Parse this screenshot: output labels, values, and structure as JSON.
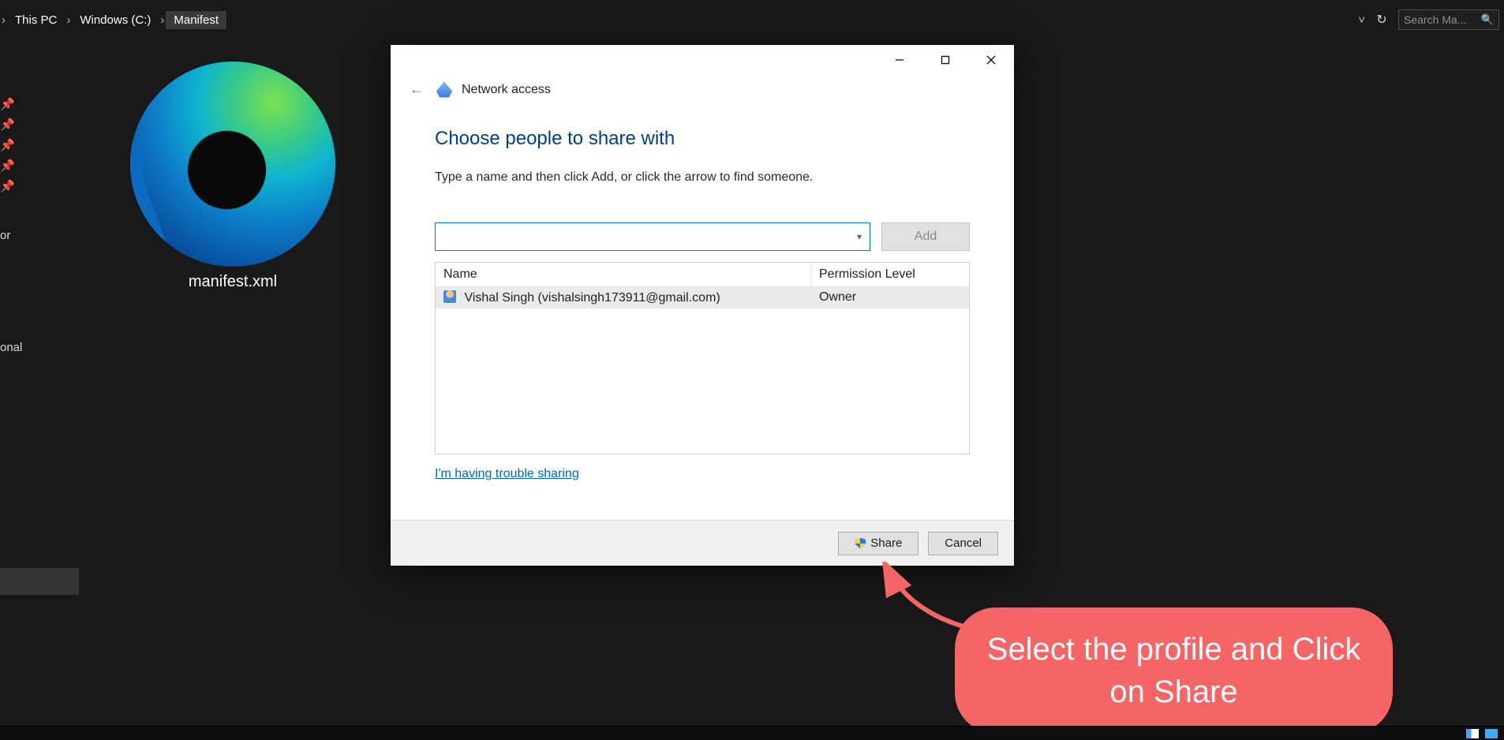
{
  "breadcrumb": {
    "items": [
      "This PC",
      "Windows (C:)",
      "Manifest"
    ],
    "search_placeholder": "Search Ma..."
  },
  "left_nav": {
    "frag1_suffix": "or",
    "frag2_suffix": "onal"
  },
  "file": {
    "name": "manifest.xml"
  },
  "dialog": {
    "title": "Network access",
    "heading": "Choose people to share with",
    "instruction": "Type a name and then click Add, or click the arrow to find someone.",
    "add_label": "Add",
    "columns": {
      "name": "Name",
      "perm": "Permission Level"
    },
    "rows": [
      {
        "display": "Vishal Singh (vishalsingh173911@gmail.com)",
        "perm": "Owner"
      }
    ],
    "trouble_link": "I'm having trouble sharing",
    "share_label": "Share",
    "cancel_label": "Cancel",
    "name_input_value": ""
  },
  "annotation": {
    "text": "Select the profile and Click on Share"
  }
}
